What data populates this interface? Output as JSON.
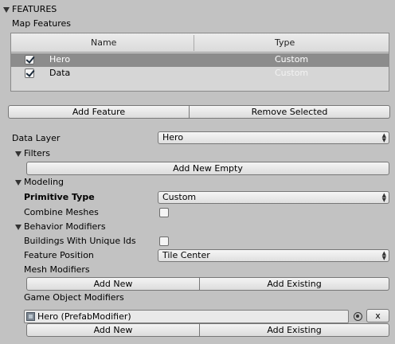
{
  "features_header": "FEATURES",
  "map_features_label": "Map Features",
  "table": {
    "columns": [
      "Name",
      "Type"
    ],
    "rows": [
      {
        "name": "Hero",
        "type": "Custom",
        "checked": true,
        "selected": true
      },
      {
        "name": "Data",
        "type": "Custom",
        "checked": true,
        "selected": false
      }
    ]
  },
  "buttons": {
    "add_feature": "Add Feature",
    "remove_selected": "Remove Selected",
    "add_new_empty": "Add New Empty",
    "mesh_add_new": "Add New",
    "mesh_add_existing": "Add Existing",
    "go_add_new": "Add New",
    "go_add_existing": "Add Existing",
    "remove_x": "x"
  },
  "data_layer": {
    "label": "Data Layer",
    "value": "Hero"
  },
  "filters": {
    "label": "Filters"
  },
  "modeling": {
    "label": "Modeling",
    "primitive_type_label": "Primitive Type",
    "primitive_type_value": "Custom",
    "combine_meshes_label": "Combine Meshes",
    "combine_meshes_checked": false
  },
  "behavior": {
    "label": "Behavior Modifiers",
    "unique_ids_label": "Buildings With Unique Ids",
    "unique_ids_checked": false,
    "feature_position_label": "Feature Position",
    "feature_position_value": "Tile Center",
    "mesh_modifiers_label": "Mesh Modifiers",
    "go_modifiers_label": "Game Object Modifiers",
    "go_modifier_item": "Hero (PrefabModifier)"
  },
  "colors": {
    "panel_bg": "#c2c2c2",
    "selected_row": "#8c8c8c"
  }
}
